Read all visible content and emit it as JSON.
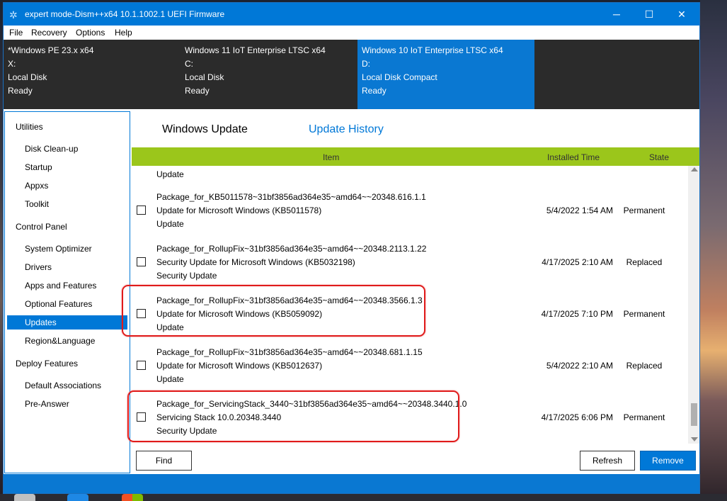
{
  "window": {
    "title": "expert mode-Dism++x64 10.1.1002.1 UEFI Firmware",
    "controls": {
      "minimize": "─",
      "maximize": "☐",
      "close": "✕"
    }
  },
  "menu": [
    "File",
    "Recovery",
    "Options",
    "Help"
  ],
  "images": [
    {
      "name": "*Windows PE 23.x x64",
      "drive": "X:",
      "type": "Local Disk",
      "status": "Ready"
    },
    {
      "name": "Windows 11 IoT Enterprise LTSC x64",
      "drive": "C:",
      "type": "Local Disk",
      "status": "Ready"
    },
    {
      "name": "Windows 10 IoT Enterprise LTSC x64",
      "drive": "D:",
      "type": "Local Disk Compact",
      "status": "Ready"
    }
  ],
  "sidebar": {
    "groups": [
      {
        "title": "Utilities",
        "items": [
          "Disk Clean-up",
          "Startup",
          "Appxs",
          "Toolkit"
        ]
      },
      {
        "title": "Control Panel",
        "items": [
          "System Optimizer",
          "Drivers",
          "Apps and Features",
          "Optional Features",
          "Updates",
          "Region&Language"
        ]
      },
      {
        "title": "Deploy Features",
        "items": [
          "Default Associations",
          "Pre-Answer"
        ]
      }
    ],
    "selected": "Updates"
  },
  "tabs": {
    "windows_update": "Windows Update",
    "update_history": "Update History"
  },
  "table": {
    "columns": {
      "item": "Item",
      "installed_time": "Installed Time",
      "state": "State"
    },
    "partial_row_text": "Update",
    "rows": [
      {
        "package": "Package_for_KB5011578~31bf3856ad364e35~amd64~~20348.616.1.1",
        "title": "Update for Microsoft Windows (KB5011578)",
        "category": "Update",
        "time": "5/4/2022 1:54 AM",
        "state": "Permanent",
        "checked": false
      },
      {
        "package": "Package_for_RollupFix~31bf3856ad364e35~amd64~~20348.2113.1.22",
        "title": "Security Update for Microsoft Windows (KB5032198)",
        "category": "Security Update",
        "time": "4/17/2025 2:10 AM",
        "state": "Replaced",
        "checked": false
      },
      {
        "package": "Package_for_RollupFix~31bf3856ad364e35~amd64~~20348.3566.1.3",
        "title": "Update for Microsoft Windows (KB5059092)",
        "category": "Update",
        "time": "4/17/2025 7:10 PM",
        "state": "Permanent",
        "checked": false
      },
      {
        "package": "Package_for_RollupFix~31bf3856ad364e35~amd64~~20348.681.1.15",
        "title": "Update for Microsoft Windows (KB5012637)",
        "category": "Update",
        "time": "5/4/2022 2:10 AM",
        "state": "Replaced",
        "checked": false
      },
      {
        "package": "Package_for_ServicingStack_3440~31bf3856ad364e35~amd64~~20348.3440.1.0",
        "title": "Servicing Stack 10.0.20348.3440",
        "category": "Security Update",
        "time": "4/17/2025 6:06 PM",
        "state": "Permanent",
        "checked": false
      }
    ]
  },
  "buttons": {
    "find": "Find",
    "refresh": "Refresh",
    "remove": "Remove"
  },
  "colors": {
    "accent": "#0078d7",
    "header_green": "#9bc61b",
    "highlight": "#e01b1b"
  }
}
